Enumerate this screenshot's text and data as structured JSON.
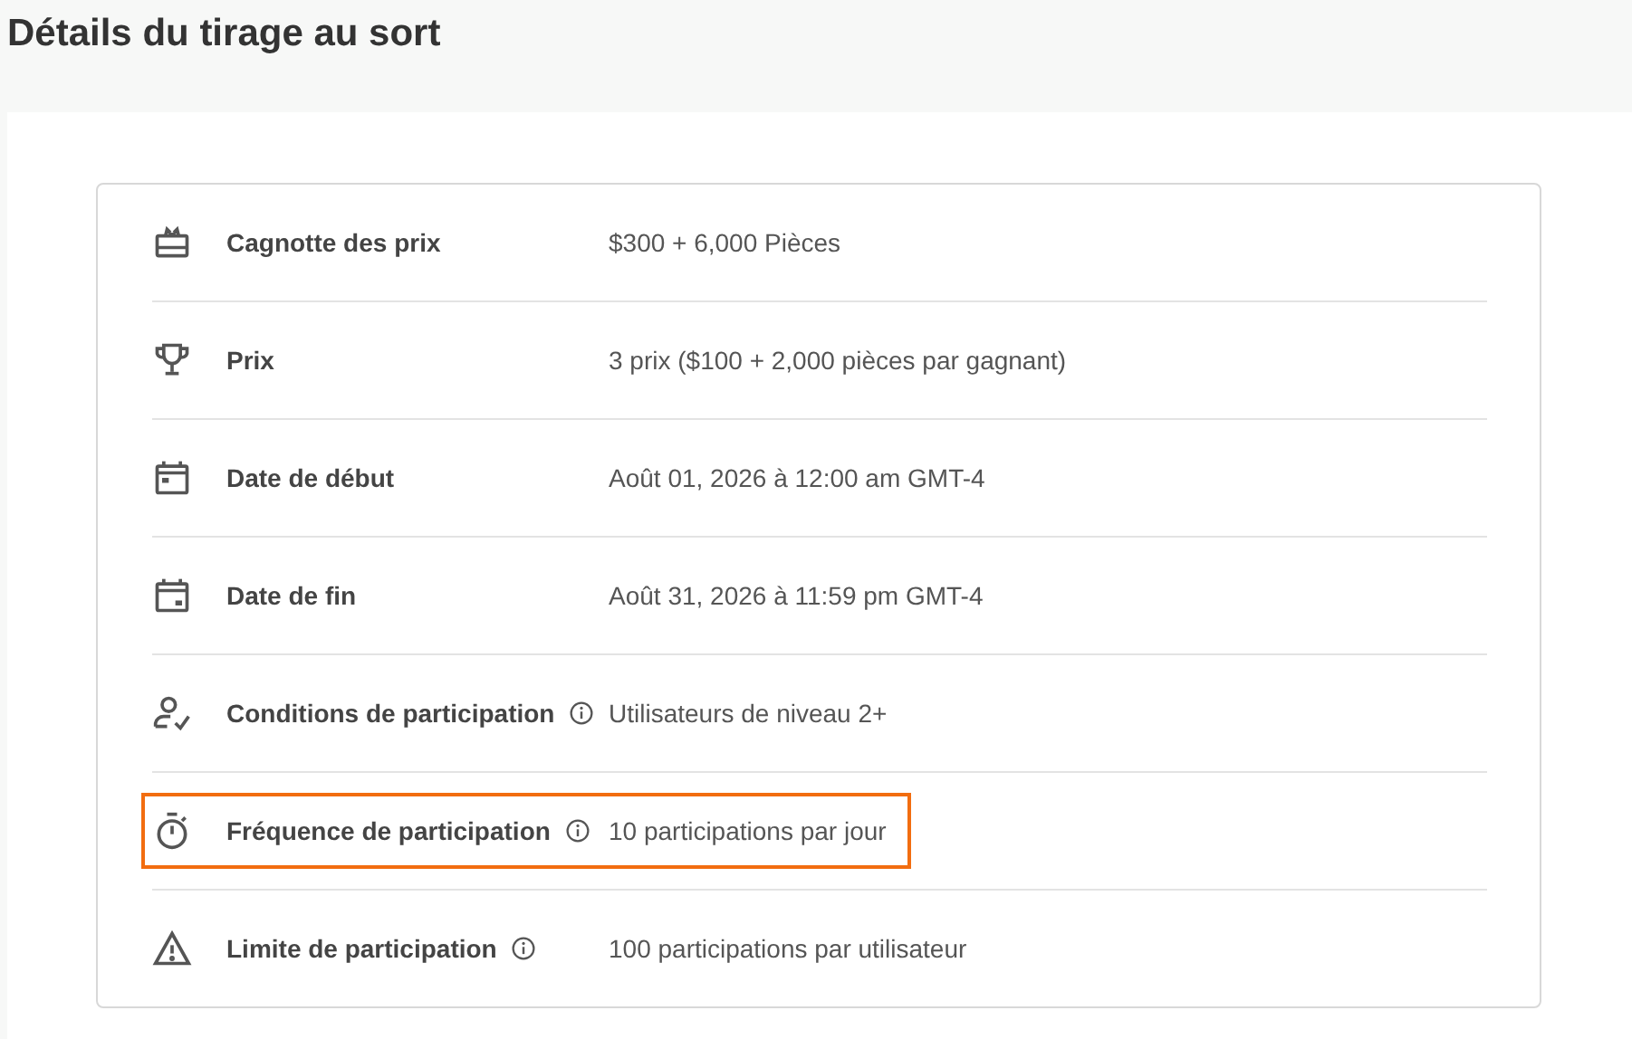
{
  "page": {
    "title": "Détails du tirage au sort"
  },
  "details": [
    {
      "kind": "gift",
      "label": "Cagnotte des prix",
      "info": false,
      "highlighted": false,
      "value": "$300 + 6,000 Pièces"
    },
    {
      "kind": "trophy",
      "label": "Prix",
      "info": false,
      "highlighted": false,
      "value": "3 prix ($100 + 2,000 pièces par gagnant)"
    },
    {
      "kind": "calendar-start",
      "label": "Date de début",
      "info": false,
      "highlighted": false,
      "value": "Août 01, 2026 à 12:00 am GMT-4"
    },
    {
      "kind": "calendar-end",
      "label": "Date de fin",
      "info": false,
      "highlighted": false,
      "value": "Août 31, 2026 à 11:59 pm GMT-4"
    },
    {
      "kind": "user-check",
      "label": "Conditions de participation",
      "info": true,
      "highlighted": false,
      "value": "Utilisateurs de niveau 2+"
    },
    {
      "kind": "stopwatch",
      "label": "Fréquence de participation",
      "info": true,
      "highlighted": true,
      "value": "10 participations par jour"
    },
    {
      "kind": "warning",
      "label": "Limite de participation",
      "info": true,
      "highlighted": false,
      "value": "100 participations par utilisateur"
    }
  ]
}
